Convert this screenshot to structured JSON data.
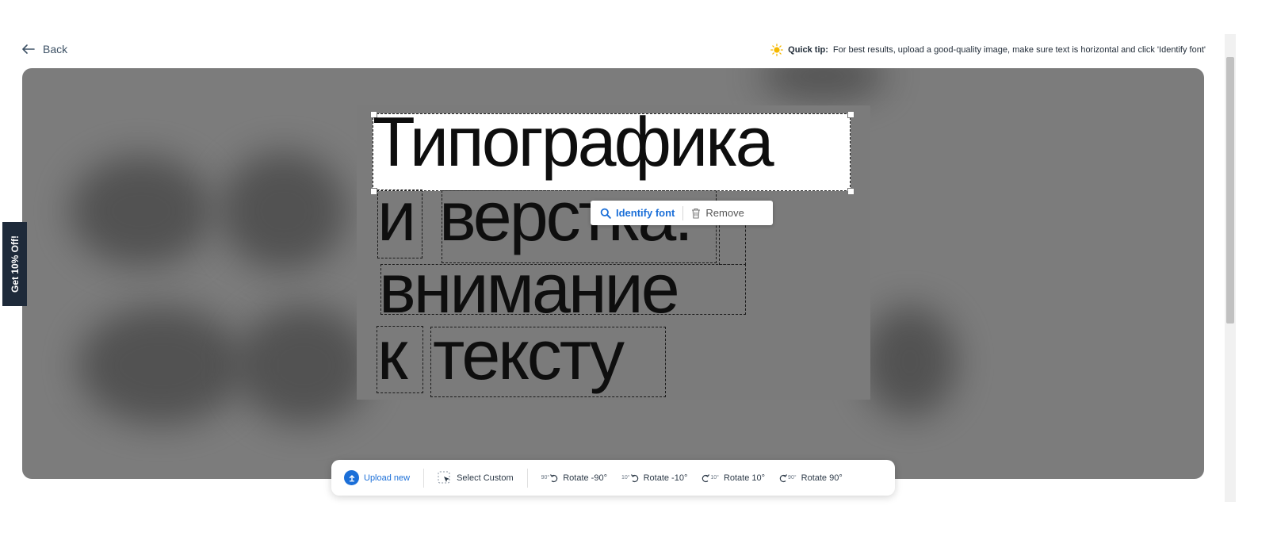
{
  "nav": {
    "back_label": "Back"
  },
  "tip": {
    "label": "Quick tip:",
    "text": "For best results, upload a good-quality image, make sure text is horizontal and click 'Identify font'"
  },
  "promo": {
    "label": "Get 10% Off!"
  },
  "canvas": {
    "lines": [
      "Типографика",
      "и",
      "верстка.",
      "внимание",
      "к",
      "тексту"
    ]
  },
  "popup": {
    "identify_label": "Identify font",
    "remove_label": "Remove"
  },
  "toolbar": {
    "upload_label": "Upload new",
    "select_label": "Select Custom",
    "rotate_minus90_label": "Rotate -90°",
    "rotate_minus10_label": "Rotate -10°",
    "rotate_plus10_label": "Rotate 10°",
    "rotate_plus90_label": "Rotate 90°",
    "rotate_minus90_badge": "90°",
    "rotate_minus10_badge": "10°",
    "rotate_plus10_badge": "10°",
    "rotate_plus90_badge": "90°"
  },
  "colors": {
    "accent": "#1b6fd8",
    "promo_bg": "#1e2a3a",
    "tip_icon": "#f5b800"
  }
}
